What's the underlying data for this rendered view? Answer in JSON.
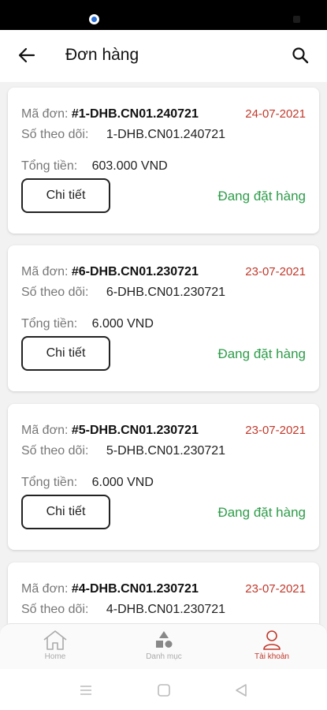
{
  "header": {
    "title": "Đơn hàng"
  },
  "labels": {
    "order_code": "Mã đơn:",
    "tracking": "Số theo dõi:",
    "total": "Tổng tiền:",
    "detail_button": "Chi tiết"
  },
  "orders": [
    {
      "code": "#1-DHB.CN01.240721",
      "date": "24-07-2021",
      "tracking": "1-DHB.CN01.240721",
      "total": "603.000 VND",
      "status": "Đang đặt hàng"
    },
    {
      "code": "#6-DHB.CN01.230721",
      "date": "23-07-2021",
      "tracking": "6-DHB.CN01.230721",
      "total": "6.000 VND",
      "status": "Đang đặt hàng"
    },
    {
      "code": "#5-DHB.CN01.230721",
      "date": "23-07-2021",
      "tracking": "5-DHB.CN01.230721",
      "total": "6.000 VND",
      "status": "Đang đặt hàng"
    },
    {
      "code": "#4-DHB.CN01.230721",
      "date": "23-07-2021",
      "tracking": "4-DHB.CN01.230721",
      "total": "",
      "status": ""
    }
  ],
  "bottom_nav": [
    {
      "label": "Home",
      "icon": "home-icon",
      "active": false
    },
    {
      "label": "Danh mục",
      "icon": "category-icon",
      "active": false
    },
    {
      "label": "Tài khoản",
      "icon": "account-icon",
      "active": true
    }
  ],
  "colors": {
    "date": "#c0392b",
    "status": "#2e9d4a",
    "active_nav": "#c0392b"
  }
}
